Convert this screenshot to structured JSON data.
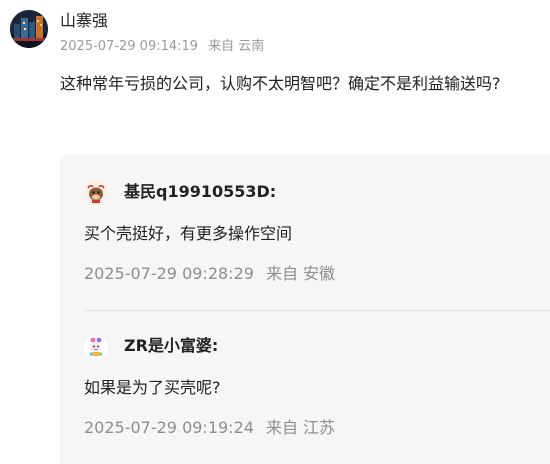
{
  "post": {
    "author": "山寨强",
    "timestamp": "2025-07-29 09:14:19",
    "source_prefix": "来自",
    "location": "云南",
    "content": "这种常年亏损的公司，认购不太明智吧？确定不是利益输送吗?",
    "avatar_icon": "city-night-avatar"
  },
  "replies": [
    {
      "name": "基民q19910553D:",
      "text": "买个壳挺好，有更多操作空间",
      "timestamp": "2025-07-29 09:28:29",
      "source_prefix": "来自",
      "location": "安徽",
      "avatar_icon": "cartoon-bull-avatar"
    },
    {
      "name": "ZR是小富婆:",
      "text": "如果是为了买壳呢?",
      "timestamp": "2025-07-29 09:19:24",
      "source_prefix": "来自",
      "location": "江苏",
      "avatar_icon": "cartoon-mascot-avatar"
    }
  ],
  "colors": {
    "reply_background": "#f6f6f7",
    "meta_text": "#9a9a9a",
    "primary_text": "#222222"
  }
}
